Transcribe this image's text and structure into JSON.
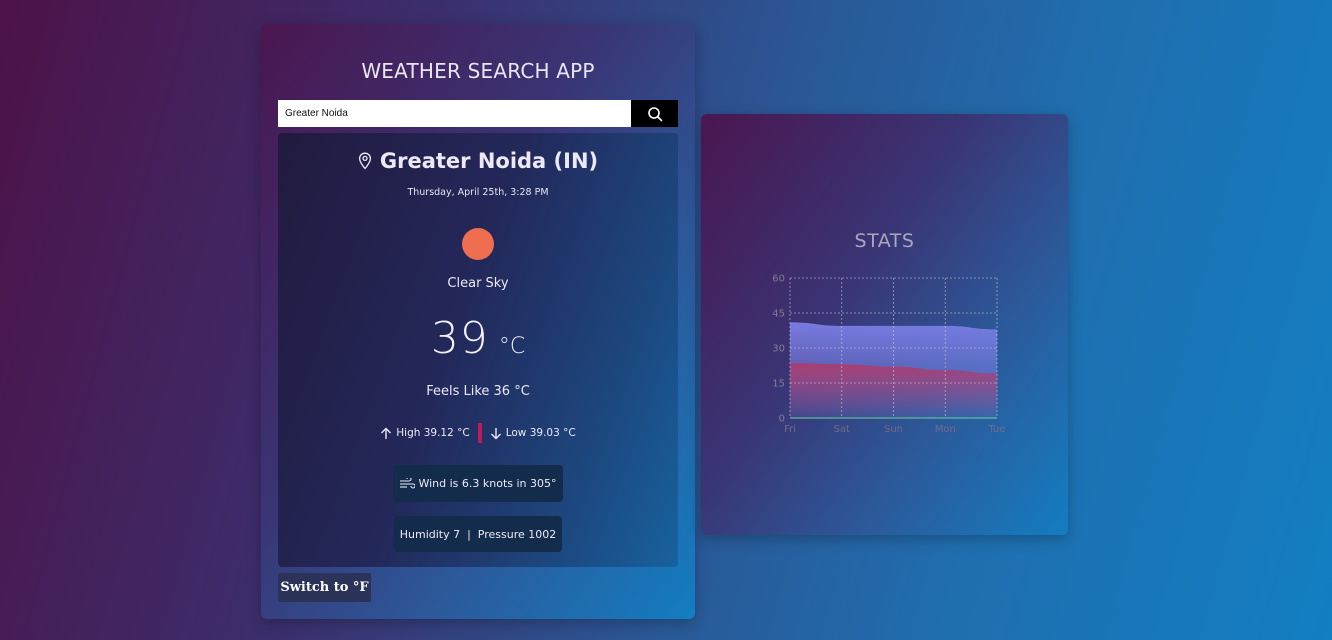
{
  "app": {
    "title": "WEATHER SEARCH APP"
  },
  "search": {
    "value": "Greater Noida",
    "button_icon": "search-icon"
  },
  "weather": {
    "location_icon": "location-pin-icon",
    "city": "Greater Noida (IN)",
    "datetime": "Thursday, April 25th, 3:28 PM",
    "condition_icon": "sun-icon",
    "condition": "Clear Sky",
    "temperature": "39",
    "temperature_unit": "°C",
    "feels_like": "Feels Like 36 °C",
    "high": "High 39.12 °C",
    "low": "Low 39.03 °C",
    "wind": "Wind is 6.3 knots in 305°",
    "humidity_pressure": "Humidity 7  |  Pressure 1002",
    "colors": {
      "sun": "#ee6e4f",
      "divider": "#c2185b"
    }
  },
  "toggle": {
    "label": "Switch to °F"
  },
  "stats": {
    "title": "STATS"
  },
  "chart_data": {
    "type": "area",
    "categories": [
      "Fri",
      "Sat",
      "Sun",
      "Mon",
      "Tue"
    ],
    "series": [
      {
        "values": [
          41,
          39.5,
          39.5,
          39.5,
          38
        ],
        "color": "#7b7fe6"
      },
      {
        "values": [
          23.5,
          23,
          22,
          20.5,
          19
        ],
        "color": "#b03a6a"
      }
    ],
    "y_ticks": [
      0,
      15,
      30,
      45,
      60
    ],
    "ylim": [
      0,
      60
    ],
    "grid": true
  }
}
